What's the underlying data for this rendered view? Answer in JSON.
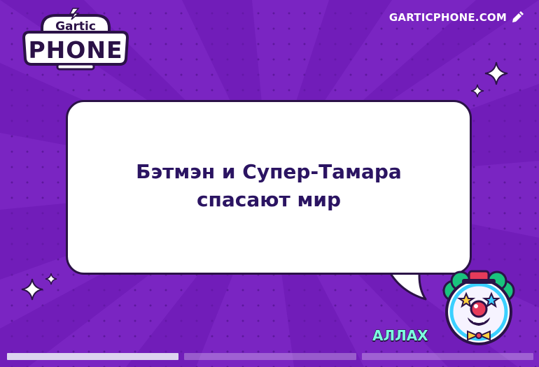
{
  "brand": {
    "logo_top": "Gartic",
    "logo_bottom": "PHONE",
    "site": "GARTICPHONE.COM"
  },
  "round": {
    "phrase_line1": "Бэтмэн и Супер-Тамара",
    "phrase_line2": "спасают мир",
    "author": "АЛЛАХ",
    "avatar_icon": "clown-avatar-icon"
  },
  "progress": {
    "segments": [
      1.0,
      0.0,
      0.0
    ]
  },
  "colors": {
    "background": "#7a25c2",
    "text_dark": "#2b1462",
    "author_name": "#7dffe0",
    "bubble": "#ffffff"
  }
}
